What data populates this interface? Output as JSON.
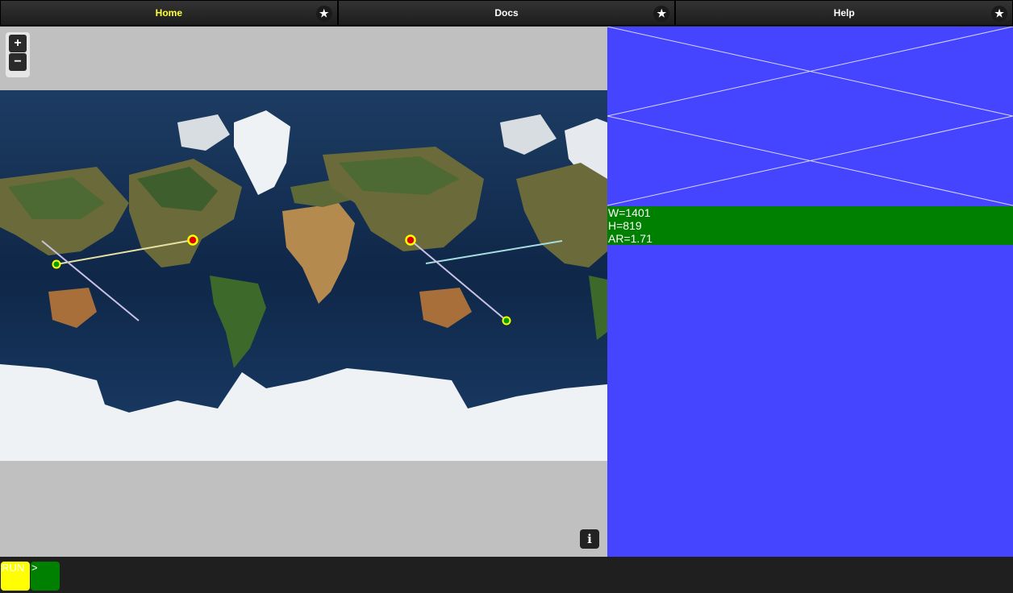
{
  "tabs": [
    {
      "label": "Home",
      "active": true
    },
    {
      "label": "Docs",
      "active": false
    },
    {
      "label": "Help",
      "active": false
    }
  ],
  "map": {
    "zoom_in": "+",
    "zoom_out": "−",
    "info": "i"
  },
  "dims": {
    "w": "W=1401",
    "h": "H=819",
    "ar": "AR=1.71"
  },
  "bottom": {
    "run": "RUN",
    "prompt": ">"
  },
  "colors": {
    "active_tab": "#ffff33",
    "panel_blue": "#4545ff",
    "dims_green": "#008000",
    "run_yellow": "#ffff00"
  }
}
